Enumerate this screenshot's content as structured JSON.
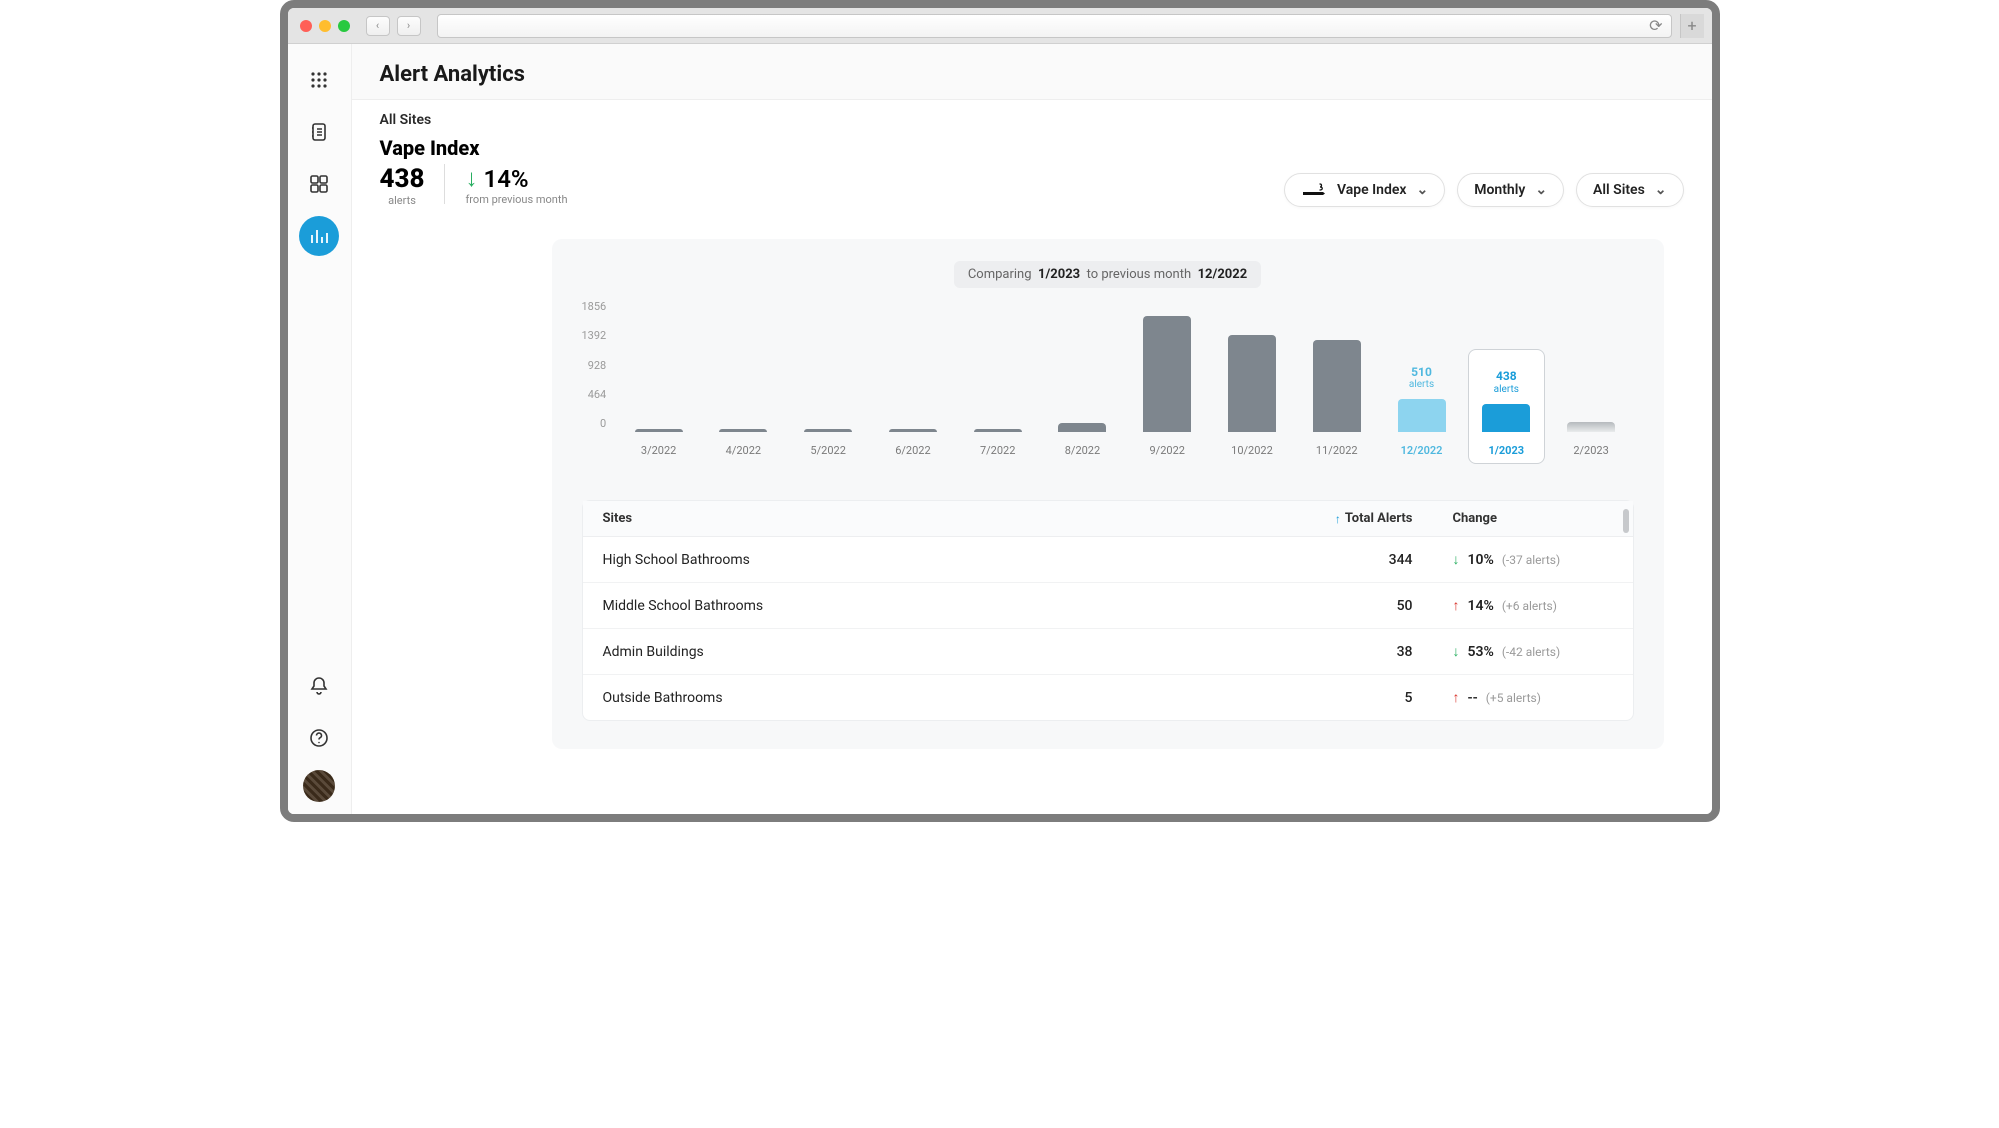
{
  "page_title": "Alert Analytics",
  "breadcrumb": "All Sites",
  "metric": {
    "title": "Vape Index",
    "value": "438",
    "value_label": "alerts",
    "change_pct": "14%",
    "change_dir": "down",
    "change_sub": "from previous month"
  },
  "filters": {
    "metric": "Vape Index",
    "period": "Monthly",
    "scope": "All Sites"
  },
  "comparing": {
    "prefix": "Comparing",
    "current": "1/2023",
    "mid": "to previous month",
    "previous": "12/2022"
  },
  "chart_data": {
    "type": "bar",
    "ylabel": "",
    "xlabel": "",
    "ylim": [
      0,
      1856
    ],
    "y_ticks": [
      1856,
      1392,
      928,
      464,
      0
    ],
    "categories": [
      "3/2022",
      "4/2022",
      "5/2022",
      "6/2022",
      "7/2022",
      "8/2022",
      "9/2022",
      "10/2022",
      "11/2022",
      "12/2022",
      "1/2023",
      "2/2023"
    ],
    "values": [
      30,
      30,
      40,
      30,
      30,
      140,
      1800,
      1500,
      1420,
      510,
      438,
      150
    ],
    "roles": [
      "past",
      "past",
      "past",
      "past",
      "past",
      "past",
      "past",
      "past",
      "past",
      "previous",
      "current",
      "future"
    ],
    "callouts": {
      "12/2022": {
        "value": "510",
        "label": "alerts"
      },
      "1/2023": {
        "value": "438",
        "label": "alerts"
      }
    }
  },
  "table": {
    "headers": {
      "sites": "Sites",
      "total": "Total Alerts",
      "change": "Change"
    },
    "sort_on": "total",
    "rows": [
      {
        "site": "High School Bathrooms",
        "total": "344",
        "dir": "down",
        "pct": "10%",
        "delta": "(-37 alerts)"
      },
      {
        "site": "Middle School Bathrooms",
        "total": "50",
        "dir": "up",
        "pct": "14%",
        "delta": "(+6 alerts)"
      },
      {
        "site": "Admin Buildings",
        "total": "38",
        "dir": "down",
        "pct": "53%",
        "delta": "(-42 alerts)"
      },
      {
        "site": "Outside Bathrooms",
        "total": "5",
        "dir": "up",
        "pct": "--",
        "delta": "(+5 alerts)"
      }
    ]
  }
}
